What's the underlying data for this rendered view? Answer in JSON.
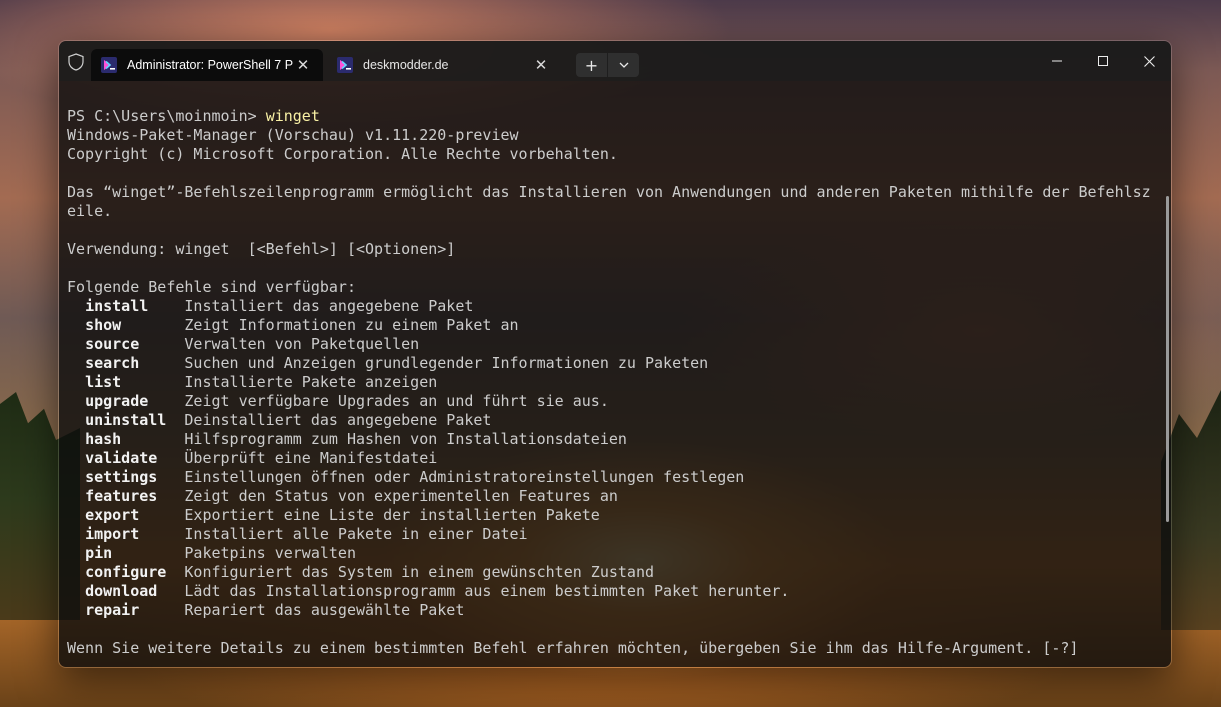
{
  "tabs": [
    {
      "title": "Administrator: PowerShell 7 P",
      "active": true,
      "icon": "powershell-icon"
    },
    {
      "title": "deskmodder.de",
      "active": false,
      "icon": "powershell-icon"
    }
  ],
  "titlebar": {
    "new_tab": "+",
    "dropdown": "⌄",
    "minimize": "─",
    "maximize": "☐",
    "close": "✕",
    "tab_close": "✕"
  },
  "terminal": {
    "prompt": "PS C:\\Users\\moinmoin> ",
    "typed_command": "winget",
    "header_lines": [
      "Windows-Paket-Manager (Vorschau) v1.11.220-preview",
      "Copyright (c) Microsoft Corporation. Alle Rechte vorbehalten."
    ],
    "description_lines": [
      "Das “winget”-Befehlszeilenprogramm ermöglicht das Installieren von Anwendungen und anderen Paketen mithilfe der Befehlsz",
      "eile."
    ],
    "usage": "Verwendung: winget  [<Befehl>] [<Optionen>]",
    "commands_heading": "Folgende Befehle sind verfügbar:",
    "commands": [
      {
        "name": "install",
        "desc": "Installiert das angegebene Paket"
      },
      {
        "name": "show",
        "desc": "Zeigt Informationen zu einem Paket an"
      },
      {
        "name": "source",
        "desc": "Verwalten von Paketquellen"
      },
      {
        "name": "search",
        "desc": "Suchen und Anzeigen grundlegender Informationen zu Paketen"
      },
      {
        "name": "list",
        "desc": "Installierte Pakete anzeigen"
      },
      {
        "name": "upgrade",
        "desc": "Zeigt verfügbare Upgrades an und führt sie aus."
      },
      {
        "name": "uninstall",
        "desc": "Deinstalliert das angegebene Paket"
      },
      {
        "name": "hash",
        "desc": "Hilfsprogramm zum Hashen von Installationsdateien"
      },
      {
        "name": "validate",
        "desc": "Überprüft eine Manifestdatei"
      },
      {
        "name": "settings",
        "desc": "Einstellungen öffnen oder Administratoreinstellungen festlegen"
      },
      {
        "name": "features",
        "desc": "Zeigt den Status von experimentellen Features an"
      },
      {
        "name": "export",
        "desc": "Exportiert eine Liste der installierten Pakete"
      },
      {
        "name": "import",
        "desc": "Installiert alle Pakete in einer Datei"
      },
      {
        "name": "pin",
        "desc": "Paketpins verwalten"
      },
      {
        "name": "configure",
        "desc": "Konfiguriert das System in einem gewünschten Zustand"
      },
      {
        "name": "download",
        "desc": "Lädt das Installationsprogramm aus einem bestimmten Paket herunter."
      },
      {
        "name": "repair",
        "desc": "Repariert das ausgewählte Paket"
      }
    ],
    "footer": "Wenn Sie weitere Details zu einem bestimmten Befehl erfahren möchten, übergeben Sie ihm das Hilfe-Argument. [-?]"
  }
}
